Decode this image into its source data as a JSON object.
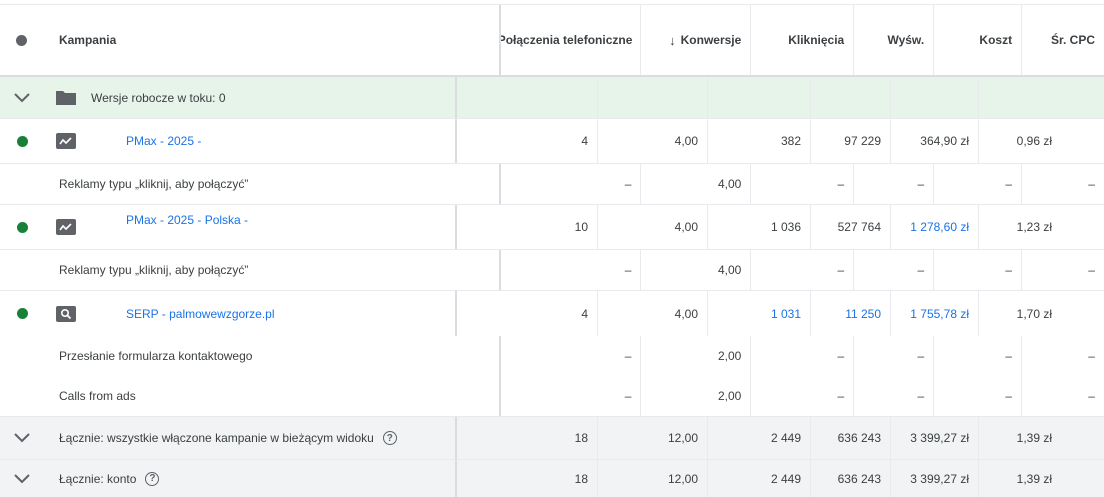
{
  "header": {
    "campaign": "Kampania",
    "calls": "Połączenia telefoniczne",
    "conversions": "Konwersje",
    "clicks": "Kliknięcia",
    "impressions": "Wyśw.",
    "cost": "Koszt",
    "cpc": "Śr. CPC",
    "sort_arrow": "↓"
  },
  "draft": {
    "label": "Wersje robocze w toku: 0"
  },
  "rows": [
    {
      "name": "PMax - 2025 -",
      "calls": "4",
      "conv": "4,00",
      "clicks": "382",
      "impr": "97 229",
      "cost": "364,90 zł",
      "cpc": "0,96 zł"
    },
    {
      "name": "Reklamy typu „kliknij, aby połączyć”",
      "calls": "–",
      "conv": "4,00",
      "clicks": "–",
      "impr": "–",
      "cost": "–",
      "cpc": "–"
    },
    {
      "name": "PMax - 2025 - Polska -",
      "calls": "10",
      "conv": "4,00",
      "clicks": "1 036",
      "impr": "527 764",
      "cost": "1 278,60 zł",
      "cpc": "1,23 zł"
    },
    {
      "name": "Reklamy typu „kliknij, aby połączyć”",
      "calls": "–",
      "conv": "4,00",
      "clicks": "–",
      "impr": "–",
      "cost": "–",
      "cpc": "–"
    },
    {
      "name": "SERP - palmowewzgorze.pl",
      "calls": "4",
      "conv": "4,00",
      "clicks": "1 031",
      "impr": "11 250",
      "cost": "1 755,78 zł",
      "cpc": "1,70 zł"
    },
    {
      "name": "Przesłanie formularza kontaktowego",
      "calls": "–",
      "conv": "2,00",
      "clicks": "–",
      "impr": "–",
      "cost": "–",
      "cpc": "–"
    },
    {
      "name": "Calls from ads",
      "calls": "–",
      "conv": "2,00",
      "clicks": "–",
      "impr": "–",
      "cost": "–",
      "cpc": "–"
    }
  ],
  "totals": [
    {
      "name": "Łącznie: wszystkie włączone kampanie w bieżącym widoku",
      "calls": "18",
      "conv": "12,00",
      "clicks": "2 449",
      "impr": "636 243",
      "cost": "3 399,27 zł",
      "cpc": "1,39 zł"
    },
    {
      "name": "Łącznie: konto",
      "calls": "18",
      "conv": "12,00",
      "clicks": "2 449",
      "impr": "636 243",
      "cost": "3 399,27 zł",
      "cpc": "1,39 zł"
    }
  ],
  "help_glyph": "?",
  "colors": {
    "status_enabled": "#188038",
    "link": "#1a73e8",
    "draft_bg": "#e6f4ea",
    "total_bg": "#f1f3f4"
  }
}
